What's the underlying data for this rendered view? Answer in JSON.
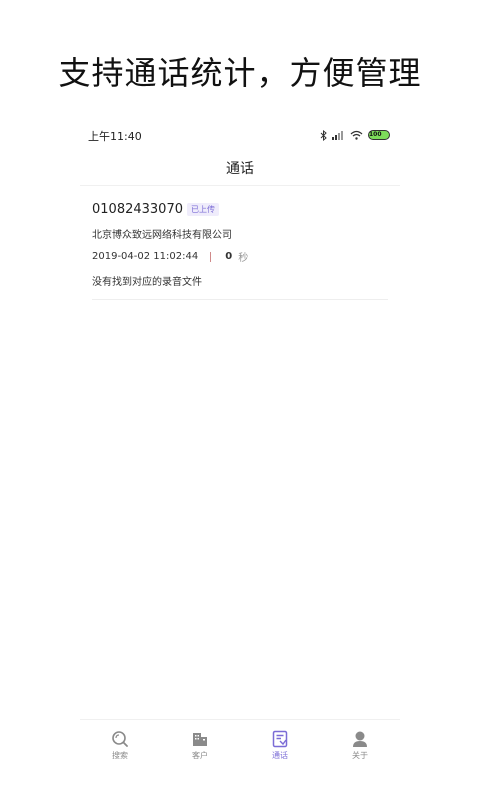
{
  "headline": "支持通话统计，方便管理",
  "statusbar": {
    "time": "上午11:40",
    "battery": "100",
    "icons": [
      "bluetooth-icon",
      "signal-icon",
      "wifi-icon",
      "battery-icon"
    ]
  },
  "nav": {
    "title": "通话"
  },
  "records": [
    {
      "phone": "01082433070",
      "badge": "已上传",
      "company": "北京博众致远网络科技有限公司",
      "datetime": "2019-04-02 11:02:44",
      "separator": "|",
      "duration": "0",
      "duration_unit": "秒",
      "note": "没有找到对应的录音文件"
    }
  ],
  "tabs": [
    {
      "label": "搜索",
      "icon": "search-icon",
      "active": false
    },
    {
      "label": "客户",
      "icon": "building-icon",
      "active": false
    },
    {
      "label": "通话",
      "icon": "call-log-icon",
      "active": true
    },
    {
      "label": "关于",
      "icon": "person-icon",
      "active": false
    }
  ],
  "colors": {
    "accent": "#7b6cd6",
    "inactive": "#8a8a8a",
    "battery": "#7ddc5a"
  }
}
